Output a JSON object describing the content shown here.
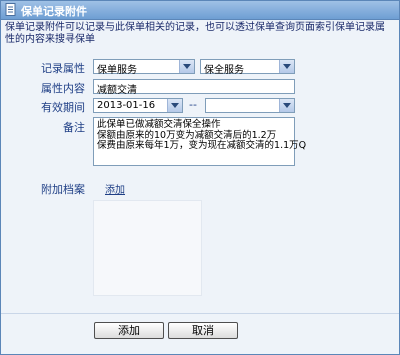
{
  "window": {
    "title": "保单记录附件"
  },
  "intro": "保单记录附件可以记录与此保单相关的记录，也可以透过保单查询页面索引保单记录属性的内容来搜寻保单",
  "form": {
    "record_attr_label": "记录属性",
    "record_attr_value1": "保单服务",
    "record_attr_value2": "保全服务",
    "attr_content_label": "属性内容",
    "attr_content_value": "减额交清",
    "validity_label": "有效期间",
    "validity_start": "2013-01-16",
    "validity_sep": "--",
    "validity_end": "",
    "remark_label": "备注",
    "remark_lines": [
      "此保单已做减额交清保全操作",
      "保额由原来的10万变为减额交清后的1.2万",
      "保费由原来每年1万，变为现在减额交清的1.1万Q"
    ],
    "attach_label": "附加档案",
    "attach_link": "添加"
  },
  "buttons": {
    "add": "添加",
    "cancel": "取消"
  },
  "colors": {
    "titlebar": "#6e9ed3",
    "label": "#1f3f86",
    "background": "#eef3f9"
  }
}
